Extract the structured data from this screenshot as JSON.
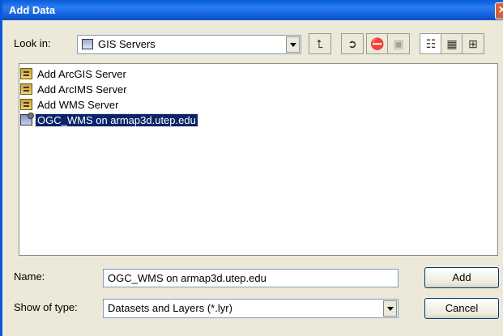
{
  "window": {
    "title": "Add Data"
  },
  "lookin": {
    "label": "Look in:",
    "value": "GIS Servers",
    "icon": "gis-servers-icon"
  },
  "toolbar": [
    {
      "name": "up-one-level-button",
      "icon": "up-folder-icon",
      "glyph": "⮤",
      "enabled": true
    },
    {
      "name": "connect-to-folder-button",
      "icon": "connect-folder-icon",
      "glyph": "➲",
      "enabled": true
    },
    {
      "name": "disconnect-button",
      "icon": "disconnect-icon",
      "glyph": "⛔",
      "enabled": false
    },
    {
      "name": "new-folder-button",
      "icon": "new-folder-icon",
      "glyph": "▣",
      "enabled": false
    },
    {
      "name": "list-view-button",
      "icon": "list-view-icon",
      "glyph": "☷",
      "enabled": true,
      "active": true
    },
    {
      "name": "details-view-button",
      "icon": "details-view-icon",
      "glyph": "▦",
      "enabled": true
    },
    {
      "name": "thumbnails-view-button",
      "icon": "thumbnails-view-icon",
      "glyph": "⊞",
      "enabled": true
    }
  ],
  "items": [
    {
      "label": "Add ArcGIS Server",
      "icon": "add-server-icon",
      "selected": false
    },
    {
      "label": "Add ArcIMS Server",
      "icon": "add-server-icon",
      "selected": false
    },
    {
      "label": "Add WMS Server",
      "icon": "add-server-icon",
      "selected": false
    },
    {
      "label": "OGC_WMS on armap3d.utep.edu",
      "icon": "wms-connection-icon",
      "selected": true
    }
  ],
  "name": {
    "label": "Name:",
    "value": "OGC_WMS on armap3d.utep.edu"
  },
  "type": {
    "label": "Show of type:",
    "value": "Datasets and Layers (*.lyr)"
  },
  "buttons": {
    "add": "Add",
    "cancel": "Cancel"
  }
}
